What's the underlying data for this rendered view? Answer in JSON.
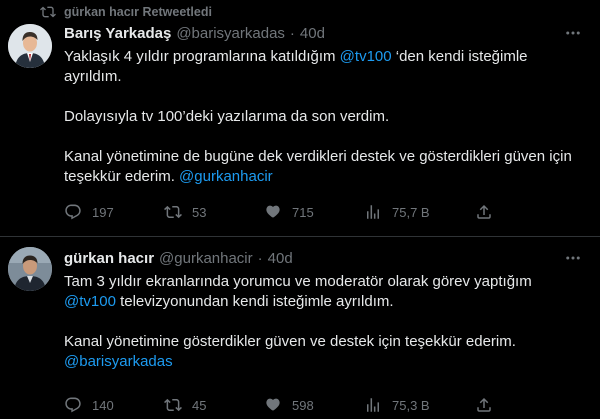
{
  "retweet_banner": {
    "text": "gürkan hacır Retweetledi"
  },
  "tweets": [
    {
      "name": "Barış Yarkadaş",
      "handle": "@barisyarkadas",
      "separator": "·",
      "time": "40d",
      "lines": [
        {
          "parts": [
            "Yaklaşık 4 yıldır programlarına katıldığım ",
            "@tv100",
            " ‘den kendi isteğimle"
          ]
        },
        {
          "parts": [
            "ayrıldım."
          ]
        },
        {
          "parts": [
            "Dolayısıyla tv 100’deki yazılarıma da son verdim."
          ]
        },
        {
          "parts": [
            "Kanal yönetimine de bugüne dek verdikleri destek ve gösterdikleri güven için"
          ]
        },
        {
          "parts": [
            "teşekkür ederim. ",
            "@gurkanhacir"
          ]
        }
      ],
      "stats": {
        "replies": "197",
        "retweets": "53",
        "likes": "715",
        "views": "75,7 B"
      }
    },
    {
      "name": "gürkan hacır",
      "handle": "@gurkanhacir",
      "separator": "·",
      "time": "40d",
      "lines": [
        {
          "parts": [
            "Tam 3 yıldır ekranlarında yorumcu ve moderatör olarak görev yaptığım"
          ]
        },
        {
          "parts": [
            "@tv100",
            " televizyonundan kendi isteğimle ayrıldım."
          ]
        },
        {
          "parts": [
            "Kanal yönetimine gösterdikler güven ve destek için teşekkür ederim."
          ]
        },
        {
          "parts": [
            "@barisyarkadas"
          ]
        }
      ],
      "stats": {
        "replies": "140",
        "retweets": "45",
        "likes": "598",
        "views": "75,3 B"
      }
    }
  ],
  "icons": {
    "retweet_banner": "retweet-icon",
    "more": "more-icon",
    "reply": "reply-icon",
    "retweet": "retweet-icon",
    "like": "heart-icon",
    "views": "views-icon",
    "share": "share-icon"
  },
  "colors": {
    "background": "#000000",
    "text": "#e7e9ea",
    "muted": "#71767b",
    "link": "#1d9bf0",
    "divider": "#2f3336"
  }
}
